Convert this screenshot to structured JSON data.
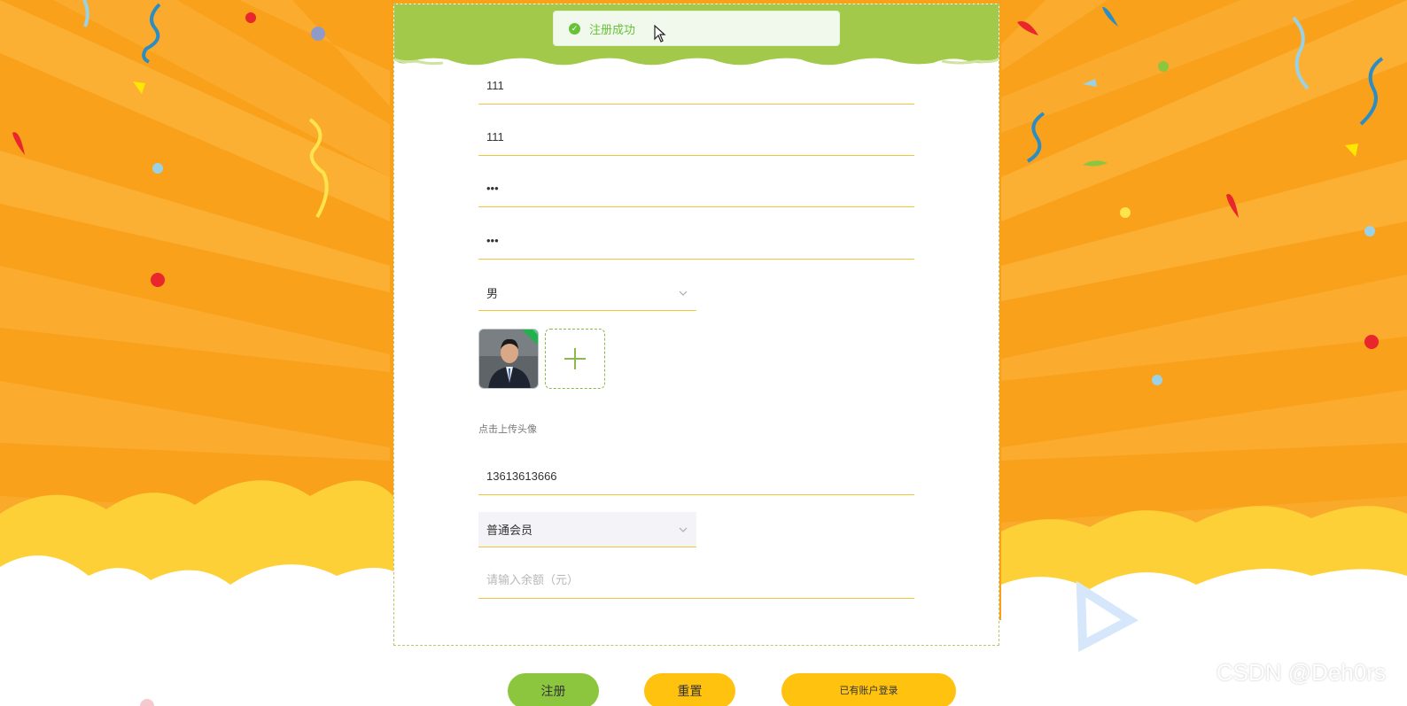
{
  "toast": {
    "message": "注册成功",
    "icon": "success-check-icon",
    "color": "#67c23a"
  },
  "form": {
    "username": {
      "value": "111"
    },
    "nickname": {
      "value": "111"
    },
    "password": {
      "value": "•••"
    },
    "confirm_password": {
      "value": "•••"
    },
    "gender": {
      "selected": "男"
    },
    "avatar_hint": "点击上传头像",
    "phone": {
      "value": "13613613666"
    },
    "member_type": {
      "selected": "普通会员"
    },
    "balance": {
      "value": "",
      "placeholder": "请输入余额（元）"
    }
  },
  "buttons": {
    "register": "注册",
    "reset": "重置",
    "login": "已有账户登录"
  },
  "watermark": "CSDN @Deh0rs",
  "colors": {
    "background": "#f9a11b",
    "header_green": "#a2c94a",
    "underline": "#f1c53b",
    "register_button": "#8cc63f",
    "yellow_button": "#ffc20e"
  }
}
